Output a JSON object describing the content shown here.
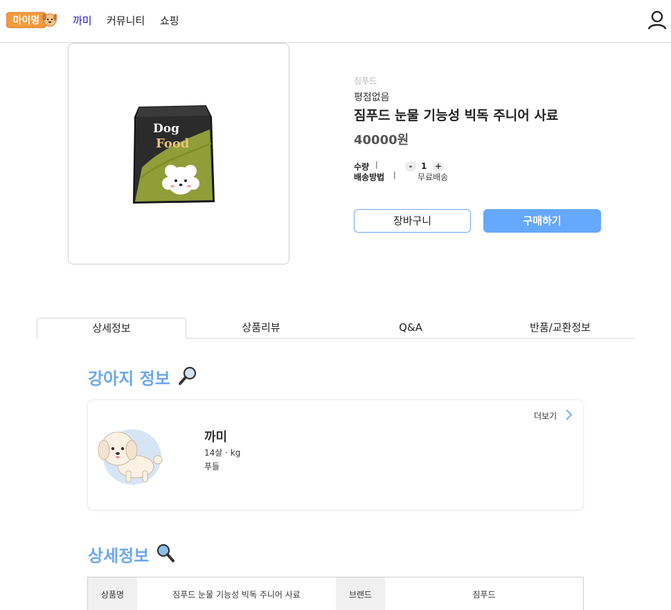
{
  "header": {
    "logo_text": "마이멍",
    "nav": [
      {
        "label": "까미",
        "active": true
      },
      {
        "label": "커뮤니티",
        "active": false
      },
      {
        "label": "쇼핑",
        "active": false
      }
    ]
  },
  "product": {
    "brand": "짐푸드",
    "rating_text": "평점없음",
    "title": "짐푸드 눈물 기능성 빅독 주니어 사료",
    "price": "40000원",
    "package_text_1": "Dog",
    "package_text_2": "Food",
    "quantity_label": "수량",
    "shipping_label": "배송방법",
    "separator": "|",
    "qty_minus": "-",
    "qty_plus": "+",
    "quantity": "1",
    "shipping_value": "무료배송",
    "cart_button": "장바구니",
    "buy_button": "구매하기"
  },
  "tabs": [
    {
      "label": "상세정보",
      "active": true
    },
    {
      "label": "상품리뷰",
      "active": false
    },
    {
      "label": "Q&A",
      "active": false
    },
    {
      "label": "반품/교환정보",
      "active": false
    }
  ],
  "dog_section": {
    "title": "강아지 정보",
    "more_label": "더보기",
    "pet_name": "까미",
    "pet_age_weight": "14살 · kg",
    "pet_breed": "푸들"
  },
  "detail_section": {
    "title": "상세정보",
    "rows": [
      {
        "label": "상품명",
        "value": "짐푸드 눈물 기능성 빅독 주니어 사료",
        "label2": "브랜드",
        "value2": "짐푸드"
      }
    ]
  },
  "colors": {
    "accent": "#66a8fb",
    "section_title": "#6aa6f0",
    "nav_active": "#1a10d8",
    "logo_orange": "#f39a3b"
  },
  "icons": {
    "user": "user-icon",
    "magnifier": "magnifier-icon",
    "more": "chevron-right-icon"
  }
}
